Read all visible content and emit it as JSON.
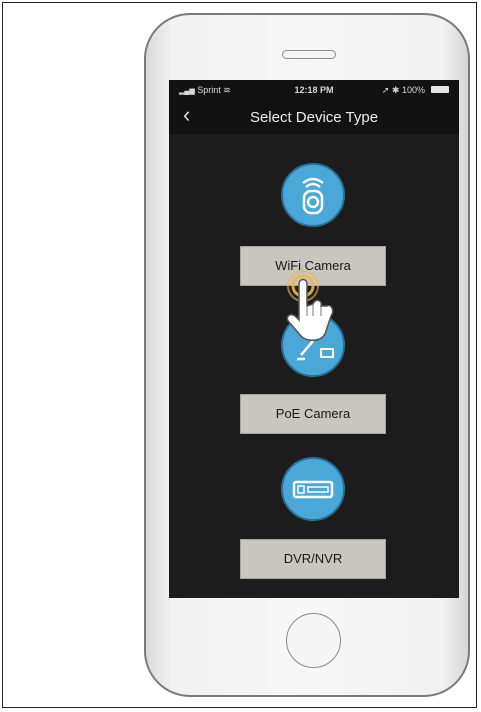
{
  "status_bar": {
    "carrier": "Sprint",
    "time": "12:18 PM",
    "battery": "100%"
  },
  "nav": {
    "title": "Select Device Type",
    "back_icon": "chevron-left-icon"
  },
  "devices": [
    {
      "label": "WiFi Camera",
      "icon": "wifi-camera-icon"
    },
    {
      "label": "PoE Camera",
      "icon": "poe-camera-icon"
    },
    {
      "label": "DVR/NVR",
      "icon": "dvr-icon"
    }
  ],
  "colors": {
    "screen_bg": "#1c1c1c",
    "icon_circle": "#4aa8d8",
    "button_bg": "#c9c5bf",
    "tap_highlight": "#e8b84a"
  }
}
